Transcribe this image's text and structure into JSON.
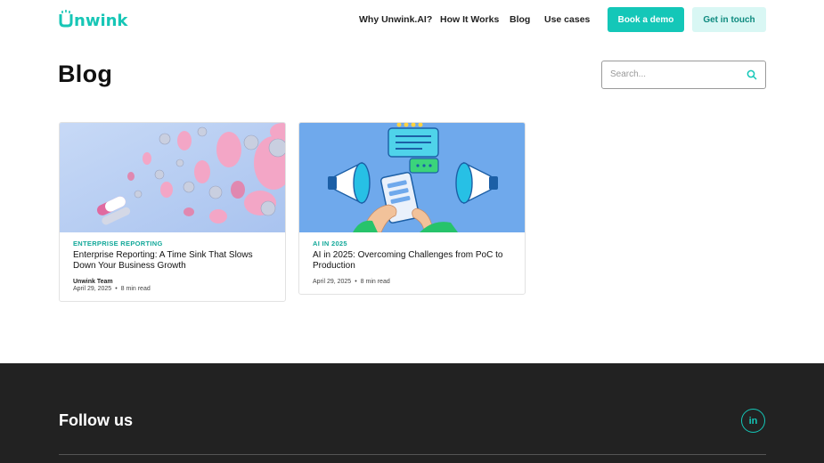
{
  "header": {
    "logo": "unwink",
    "nav": [
      "Why Unwink.AI?",
      "How It Works",
      "Blog",
      "Use cases"
    ],
    "book_demo": "Book a demo",
    "get_in_touch": "Get in touch"
  },
  "page": {
    "title": "Blog",
    "search_placeholder": "Search..."
  },
  "posts": [
    {
      "category": "ENTERPRISE REPORTING",
      "title": "Enterprise Reporting: A Time Sink That Slows Down Your Business Growth",
      "author": "Unwink Team",
      "date": "April 29, 2025",
      "read_time": "8 min read"
    },
    {
      "category": "AI IN 2025",
      "title": "AI in 2025: Overcoming Challenges from PoC to Production",
      "date": "April 29, 2025",
      "read_time": "8 min read"
    }
  ],
  "footer": {
    "follow": "Follow us",
    "social": "in"
  },
  "colors": {
    "accent": "#14c7b8",
    "footer_bg": "#222222"
  }
}
